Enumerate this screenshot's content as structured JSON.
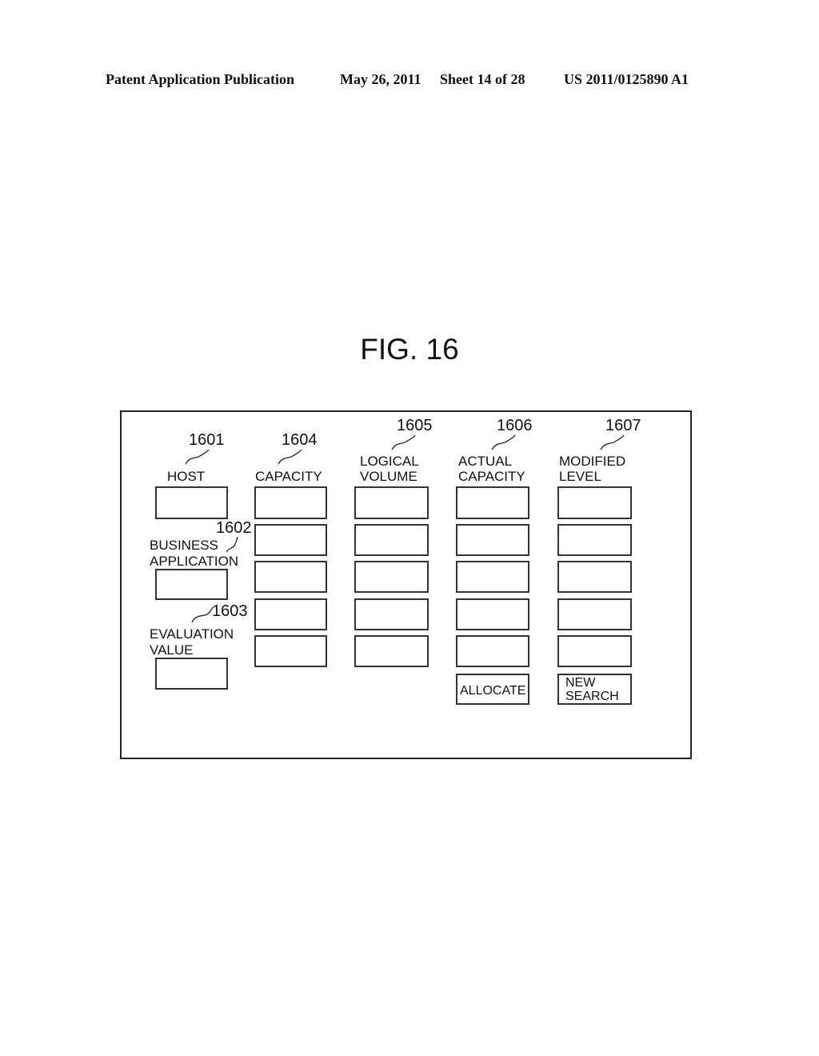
{
  "header": {
    "publication": "Patent Application Publication",
    "date": "May 26, 2011",
    "sheet": "Sheet 14 of 28",
    "number": "US 2011/0125890 A1"
  },
  "figure": {
    "title": "FIG. 16"
  },
  "screen": {
    "left_column": {
      "host": {
        "ref": "1601",
        "label": "HOST",
        "value": ""
      },
      "business_application": {
        "ref": "1602",
        "label_line1": "BUSINESS",
        "label_line2": "APPLICATION",
        "value": ""
      },
      "evaluation_value": {
        "ref": "1603",
        "label_line1": "EVALUATION",
        "label_line2": "VALUE",
        "value": ""
      }
    },
    "columns": [
      {
        "ref": "1604",
        "label_line1": "CAPACITY",
        "label_line2": "",
        "rows": [
          "",
          "",
          "",
          "",
          ""
        ]
      },
      {
        "ref": "1605",
        "label_line1": "LOGICAL",
        "label_line2": "VOLUME",
        "rows": [
          "",
          "",
          "",
          "",
          ""
        ]
      },
      {
        "ref": "1606",
        "label_line1": "ACTUAL",
        "label_line2": "CAPACITY",
        "rows": [
          "",
          "",
          "",
          "",
          ""
        ]
      },
      {
        "ref": "1607",
        "label_line1": "MODIFIED",
        "label_line2": "LEVEL",
        "rows": [
          "",
          "",
          "",
          "",
          ""
        ]
      }
    ],
    "buttons": {
      "allocate": "ALLOCATE",
      "new_search_line1": "NEW",
      "new_search_line2": "SEARCH"
    }
  }
}
